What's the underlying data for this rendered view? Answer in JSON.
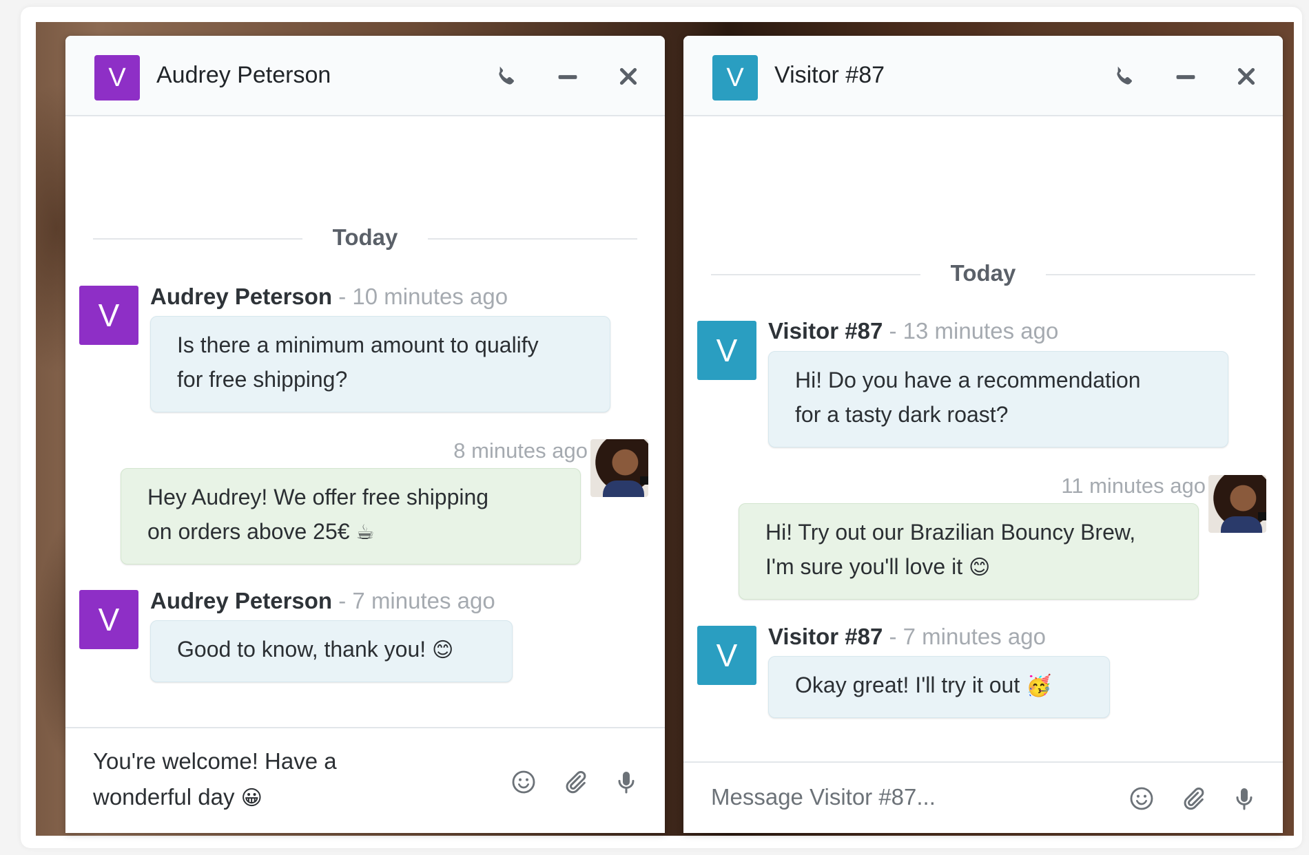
{
  "left_chat": {
    "avatar_letter": "V",
    "title": "Audrey Peterson",
    "day_label": "Today",
    "messages": [
      {
        "author": "Audrey Peterson",
        "time": "- 10 minutes ago",
        "line1": "Is there a minimum amount to qualify",
        "line2": "for free shipping?"
      },
      {
        "time": "8 minutes ago",
        "line1": "Hey Audrey! We offer free shipping",
        "line2": "on orders above 25€",
        "emoji": "☕"
      },
      {
        "author": "Audrey Peterson",
        "time": "- 7 minutes ago",
        "line1": "Good to know, thank you!",
        "emoji": "😊"
      }
    ],
    "draft": {
      "line1": "You're welcome! Have a",
      "line2": "wonderful day",
      "emoji": "😀"
    }
  },
  "right_chat": {
    "avatar_letter": "V",
    "title": "Visitor #87",
    "day_label": "Today",
    "messages": [
      {
        "author": "Visitor #87",
        "time": "- 13 minutes ago",
        "line1": "Hi! Do you have a recommendation",
        "line2": "for a tasty dark roast?"
      },
      {
        "time": "11 minutes ago",
        "line1": "Hi! Try out our Brazilian Bouncy Brew,",
        "line2": "I'm sure you'll love it",
        "emoji": "😊"
      },
      {
        "author": "Visitor #87",
        "time": "- 7 minutes ago",
        "line1": "Okay great! I'll try it out",
        "emoji": "🥳"
      }
    ],
    "placeholder": "Message Visitor #87..."
  },
  "colors": {
    "purple_avatar": "#8e2fc6",
    "teal_avatar": "#2a9ec1",
    "incoming_bubble": "#e9f3f7",
    "outgoing_bubble": "#e8f3e6"
  },
  "icons": [
    "phone-icon",
    "minimize-icon",
    "close-icon",
    "emoji-icon",
    "paperclip-icon",
    "microphone-icon"
  ]
}
